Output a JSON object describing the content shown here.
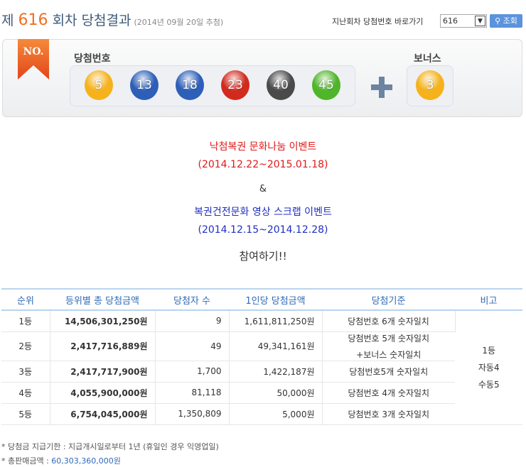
{
  "header": {
    "prefix": "제",
    "round": "616",
    "suffix": "회차 당첨결과",
    "date": "(2014년 09월 20일 추첨)",
    "goto_label": "지난회차 당첨번호 바로가기",
    "select_value": "616",
    "search_label": "조회"
  },
  "draw": {
    "ribbon": "NO.",
    "numbers_label": "당첨번호",
    "bonus_label": "보너스",
    "balls": [
      {
        "n": "5",
        "color": "#f5b21c"
      },
      {
        "n": "13",
        "color": "#2d5fb8"
      },
      {
        "n": "18",
        "color": "#2d5fb8"
      },
      {
        "n": "23",
        "color": "#d22a1e"
      },
      {
        "n": "40",
        "color": "#4a4a4a"
      },
      {
        "n": "45",
        "color": "#4fb52a"
      }
    ],
    "bonus": {
      "n": "3",
      "color": "#f5b21c"
    }
  },
  "event": {
    "line1": "낙첨복권 문화나눔 이벤트",
    "line2": "(2014.12.22~2015.01.18)",
    "amp": "&",
    "line3": "복권건전문화 영상 스크랩 이벤트",
    "line4": "(2014.12.15~2014.12.28)",
    "join": "참여하기!!"
  },
  "table": {
    "headers": [
      "순위",
      "등위별 총 당첨금액",
      "당첨자 수",
      "1인당 당첨금액",
      "당첨기준",
      "비고"
    ],
    "rows": [
      {
        "rank": "1등",
        "total": "14,506,301,250원",
        "winners": "9",
        "per": "1,611,811,250원",
        "crit": "당첨번호 6개 숫자일치"
      },
      {
        "rank": "2등",
        "total": "2,417,716,889원",
        "winners": "49",
        "per": "49,341,161원",
        "crit": "당첨번호 5개 숫자일치",
        "crit2": "+보너스 숫자일치"
      },
      {
        "rank": "3등",
        "total": "2,417,717,900원",
        "winners": "1,700",
        "per": "1,422,187원",
        "crit": "당첨번호5개 숫자일치"
      },
      {
        "rank": "4등",
        "total": "4,055,900,000원",
        "winners": "81,118",
        "per": "50,000원",
        "crit": "당첨번호 4개 숫자일치"
      },
      {
        "rank": "5등",
        "total": "6,754,045,000원",
        "winners": "1,350,809",
        "per": "5,000원",
        "crit": "당첨번호 3개 숫자일치"
      }
    ],
    "note": [
      "1등",
      "자동4",
      "수동5"
    ]
  },
  "footer": {
    "deadline": "* 당첨금 지급기한 : 지급개시일로부터 1년 (휴일인 경우 익영업일)",
    "sales_label": "* 총판매금액 : ",
    "sales_value": "60,303,360,000원"
  }
}
